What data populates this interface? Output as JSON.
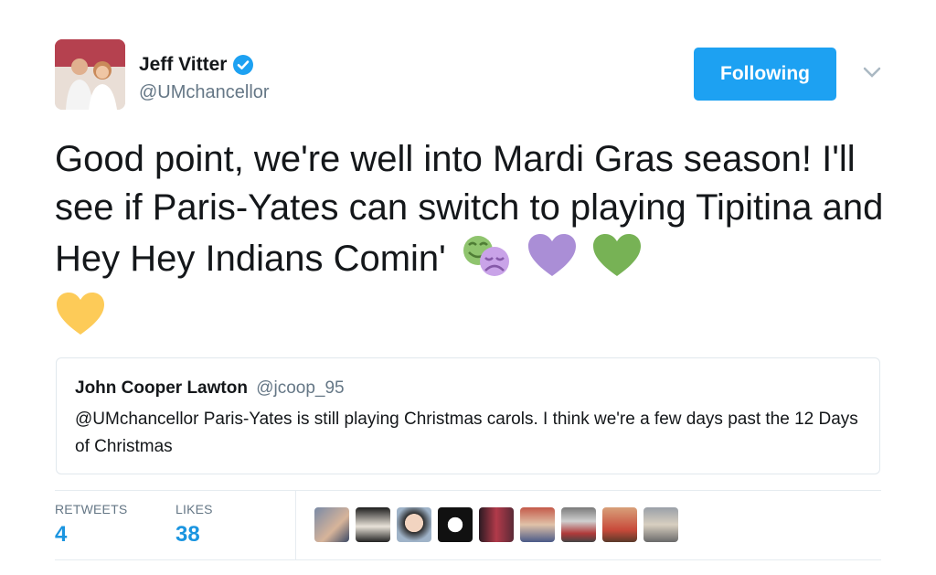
{
  "author": {
    "name": "Jeff Vitter",
    "handle": "@UMchancellor"
  },
  "follow_label": "Following",
  "tweet": {
    "text": "Good point, we're well into Mardi Gras season! I'll see if Paris-Yates can switch to playing Tipitina and Hey Hey Indians Comin'",
    "emojis": [
      "performing-arts-emoji",
      "purple-heart-emoji",
      "green-heart-emoji",
      "yellow-heart-emoji"
    ]
  },
  "quoted": {
    "name": "John Cooper Lawton",
    "handle": "@jcoop_95",
    "text": "@UMchancellor Paris-Yates is still playing Christmas carols. I think we're a few days past the 12 Days of Christmas"
  },
  "stats": {
    "retweets_label": "RETWEETS",
    "retweets": "4",
    "likes_label": "LIKES",
    "likes": "38"
  },
  "colors": {
    "accent": "#1da1f2",
    "stat_blue": "#1b95e0",
    "muted": "#657786",
    "border": "#e1e8ed"
  }
}
